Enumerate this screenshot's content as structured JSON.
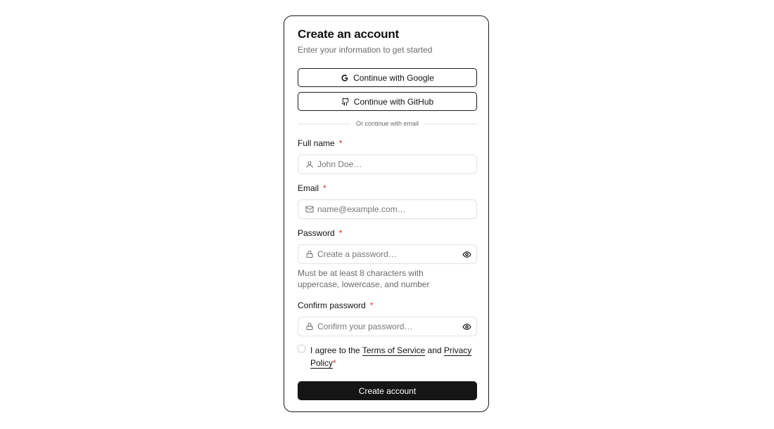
{
  "header": {
    "title": "Create an account",
    "subtitle": "Enter your information to get started"
  },
  "oauth": {
    "google_label": "Continue with Google",
    "github_label": "Continue with GitHub"
  },
  "divider_text": "Or continue with email",
  "required_marker": "*",
  "fields": {
    "full_name": {
      "label": "Full name",
      "placeholder": "John Doe…",
      "value": ""
    },
    "email": {
      "label": "Email",
      "placeholder": "name@example.com…",
      "value": ""
    },
    "password": {
      "label": "Password",
      "placeholder": "Create a password…",
      "value": "",
      "hint": "Must be at least 8 characters with uppercase, lowercase, and number"
    },
    "confirm_password": {
      "label": "Confirm password",
      "placeholder": "Confirm your password…",
      "value": ""
    }
  },
  "terms": {
    "prefix": "I agree to the",
    "terms_link": "Terms of Service",
    "conjunction": "and",
    "privacy_link": "Privacy Policy",
    "checked": false
  },
  "submit_label": "Create account",
  "icons": {
    "google": "google-icon",
    "github": "github-icon",
    "user": "user-icon",
    "mail": "mail-icon",
    "lock": "lock-icon",
    "eye": "eye-icon"
  },
  "colors": {
    "primary_button": "#151515",
    "required": "#d32f2f",
    "muted_text": "#6b6b6b",
    "border": "#1a1a1a"
  }
}
